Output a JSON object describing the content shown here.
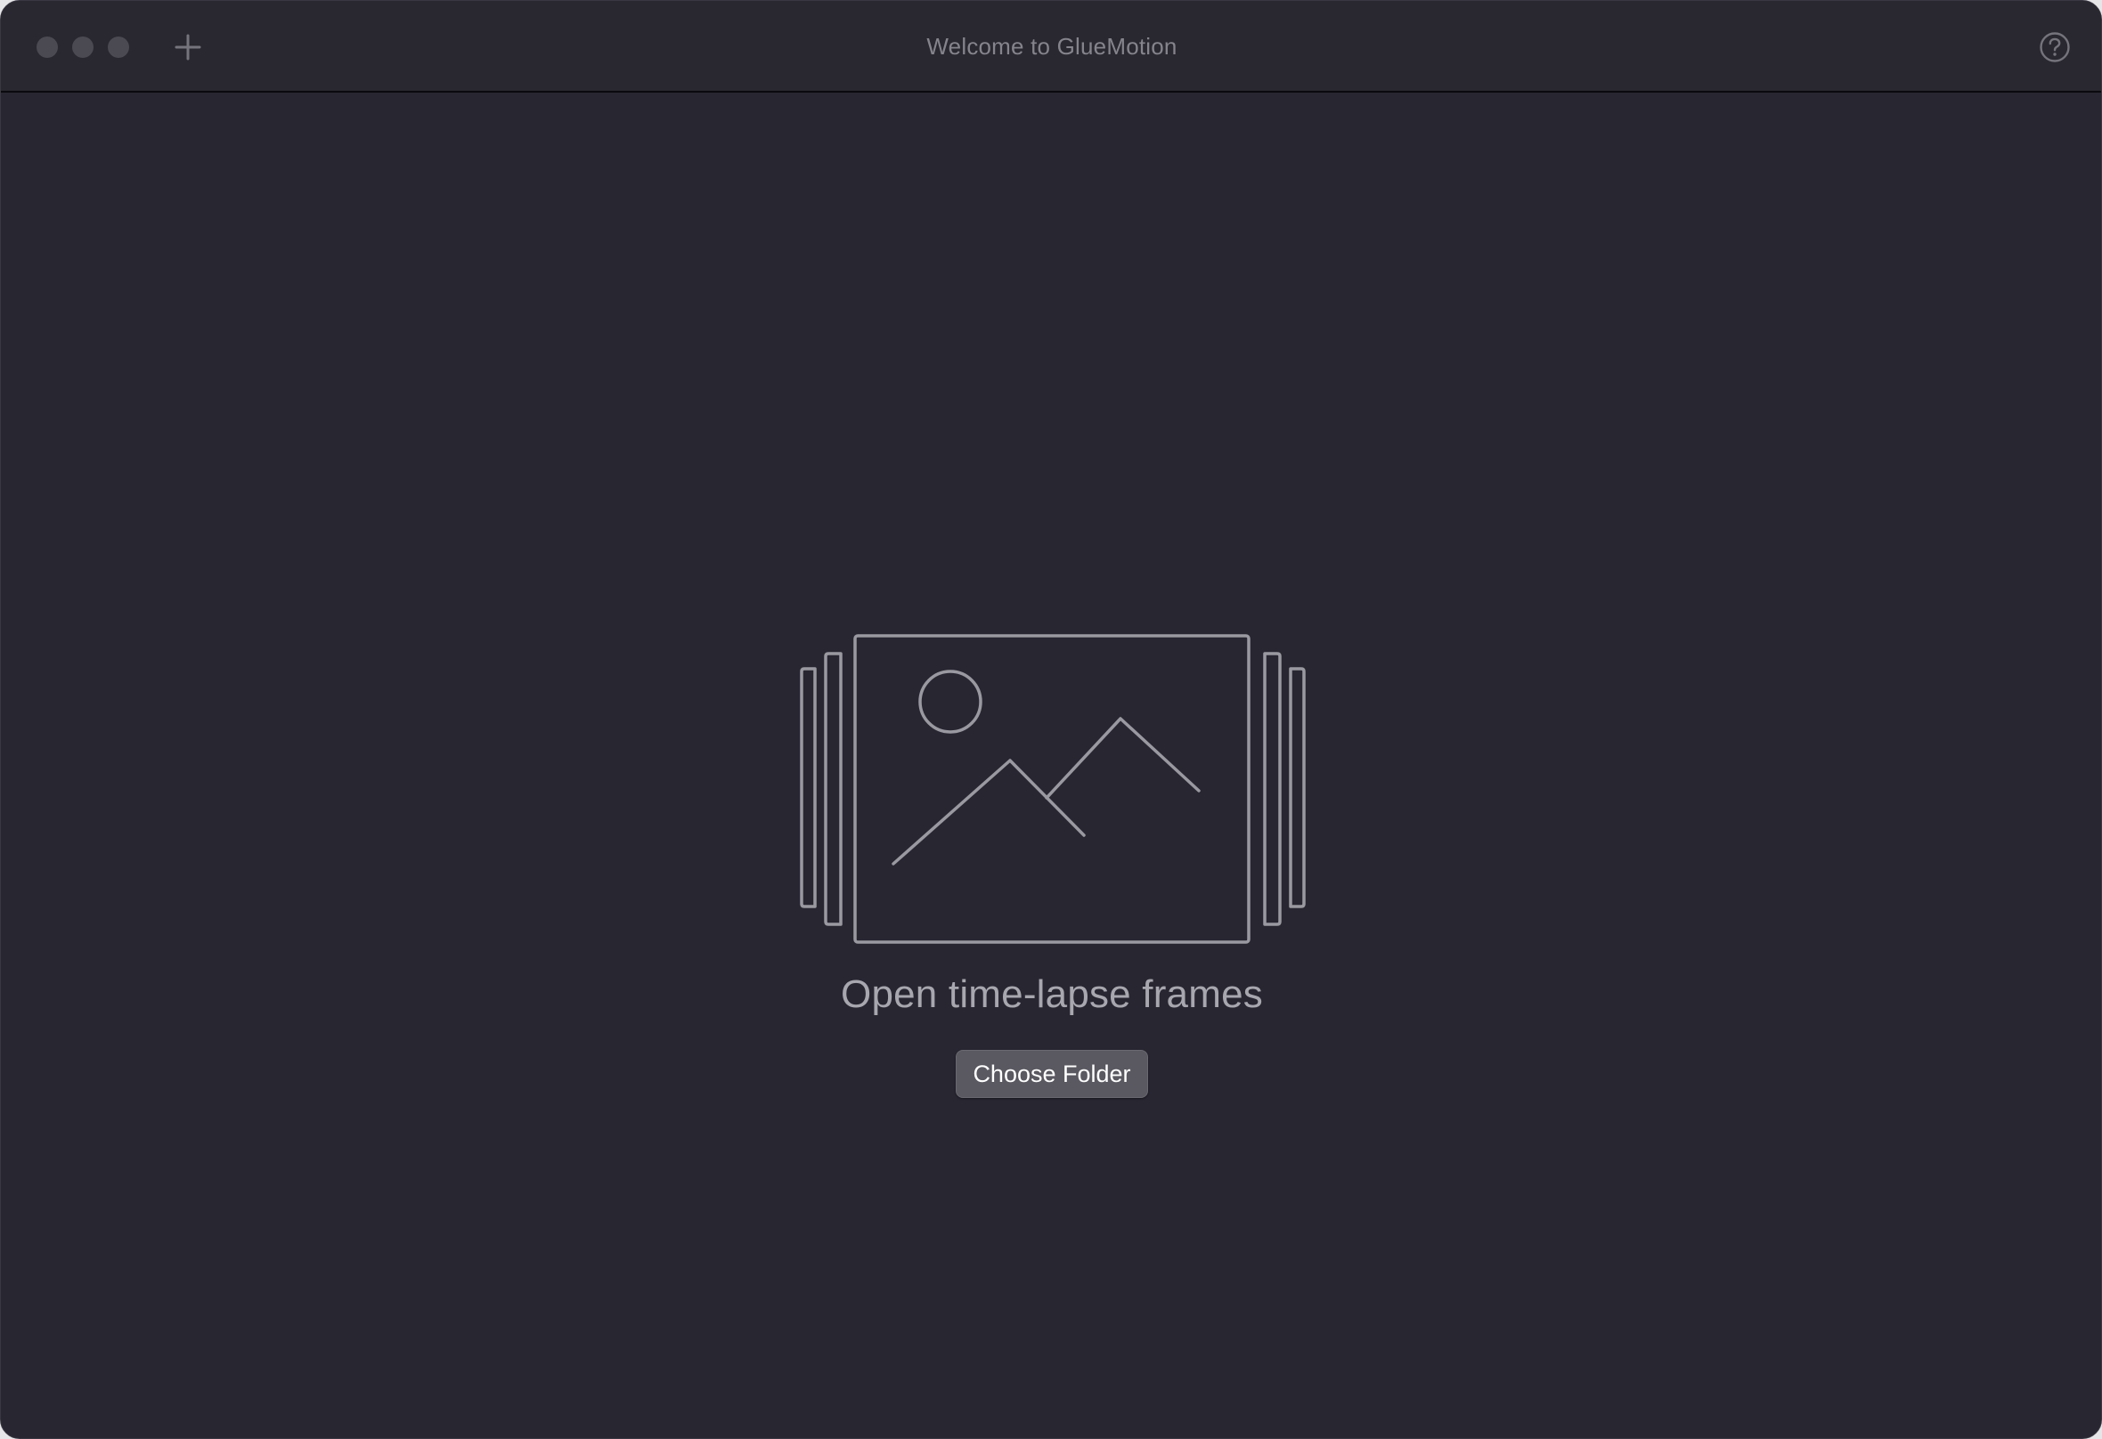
{
  "window": {
    "title": "Welcome to GlueMotion"
  },
  "empty_state": {
    "headline": "Open time-lapse frames",
    "button_label": "Choose Folder",
    "illustration_icon": "image-frames-icon"
  },
  "toolbar": {
    "new_tab_icon": "plus-icon",
    "help_icon": "question-circle-icon"
  },
  "colors": {
    "background": "#282631",
    "titlebar": "#29272f",
    "button": "#5a5860",
    "illustration_stroke": "#9a98a0"
  }
}
